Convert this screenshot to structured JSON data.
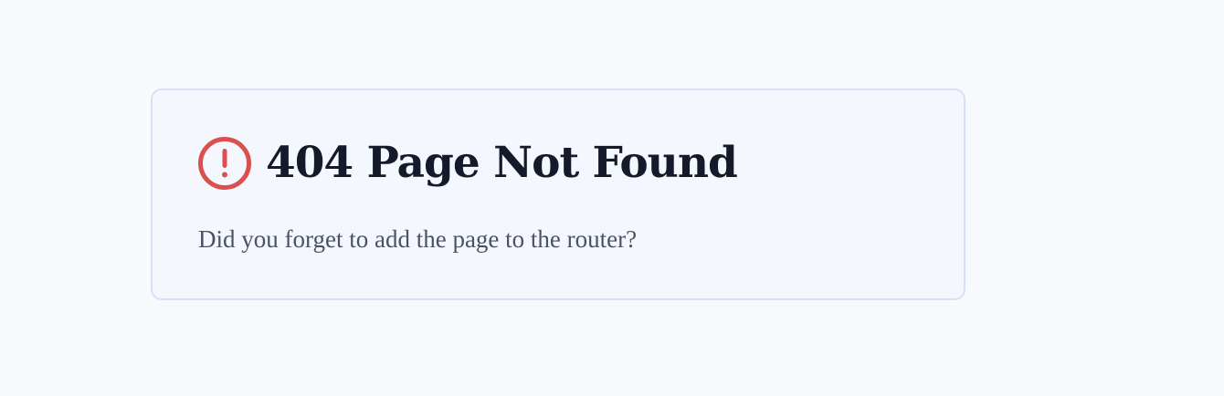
{
  "not_found_card": {
    "icon": "alert-circle-icon",
    "icon_color": "#db4f4f",
    "title": "404 Page Not Found",
    "message": "Did you forget to add the page to the router?"
  }
}
